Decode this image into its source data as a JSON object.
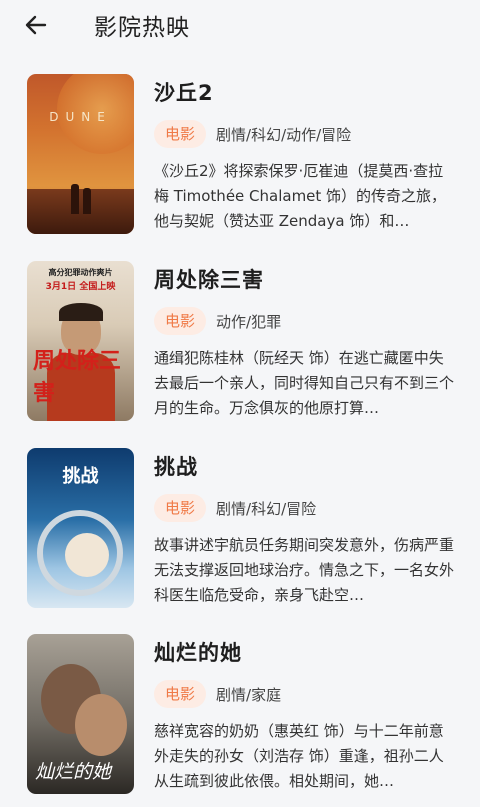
{
  "header": {
    "title": "影院热映"
  },
  "movies": [
    {
      "name": "沙丘2",
      "badge": "电影",
      "genre": "剧情/科幻/动作/冒险",
      "desc": "《沙丘2》将探索保罗·厄崔迪（提莫西·查拉梅 Timothée Chalamet 饰）的传奇之旅，他与契妮（赞达亚 Zendaya 饰）和…",
      "poster_text": "DUNE"
    },
    {
      "name": "周处除三害",
      "badge": "电影",
      "genre": "动作/犯罪",
      "desc": "通缉犯陈桂林（阮经天 饰）在逃亡藏匿中失去最后一个亲人，同时得知自己只有不到三个月的生命。万念俱灰的他原打算…",
      "poster_top": "高分犯罪动作爽片",
      "poster_date": "3月1日 全国上映",
      "poster_title": "周处除三害"
    },
    {
      "name": "挑战",
      "badge": "电影",
      "genre": "剧情/科幻/冒险",
      "desc": "故事讲述宇航员任务期间突发意外，伤病严重无法支撑返回地球治疗。情急之下，一名女外科医生临危受命，亲身飞赴空…",
      "poster_title": "挑战"
    },
    {
      "name": "灿烂的她",
      "badge": "电影",
      "genre": "剧情/家庭",
      "desc": "慈祥宽容的奶奶（惠英红 饰）与十二年前意外走失的孙女（刘浩存 饰）重逢，祖孙二人从生疏到彼此依偎。相处期间，她…",
      "poster_title": "灿烂的她"
    }
  ]
}
